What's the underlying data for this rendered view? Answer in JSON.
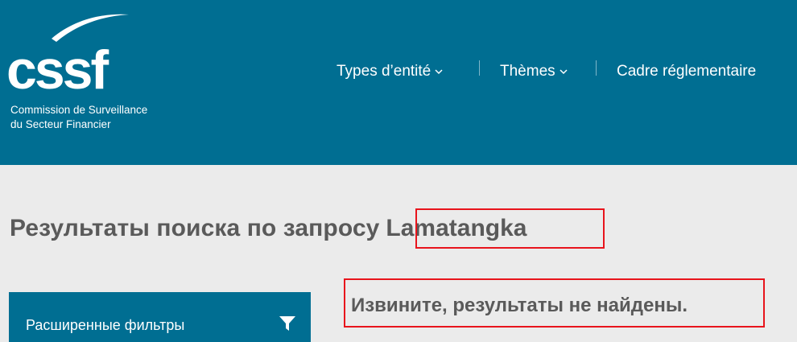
{
  "header": {
    "logo_text": "cssf",
    "logo_sub_line1": "Commission de Surveillance",
    "logo_sub_line2": "du Secteur Financier",
    "nav": [
      {
        "label": "Types d’entité",
        "has_dropdown": true
      },
      {
        "label": "Thèmes",
        "has_dropdown": true
      },
      {
        "label": "Cadre réglementaire",
        "has_dropdown": false
      }
    ]
  },
  "search": {
    "title_prefix": "Результаты поиска по запросу",
    "query": "Lamatangka",
    "no_results": "Извините, результаты не найдены."
  },
  "filters": {
    "label": "Расширенные фильтры",
    "icon": "filter-icon"
  },
  "colors": {
    "brand": "#006e92",
    "background": "#ebebeb",
    "text": "#5a5a5a",
    "highlight_box": "#e8141c"
  }
}
